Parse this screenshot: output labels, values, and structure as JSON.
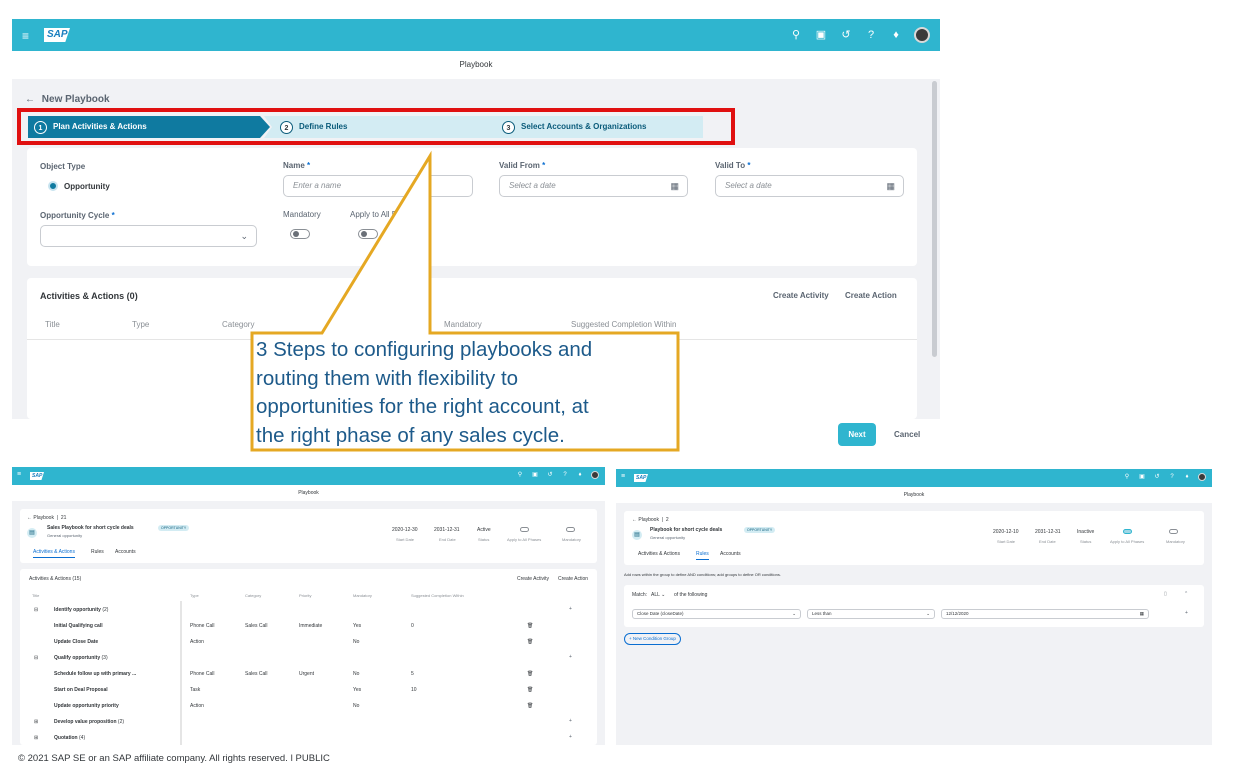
{
  "main": {
    "shell_menu_icon": "≡",
    "logo": "SAP",
    "page_title": "Playbook",
    "back_label": "New Playbook",
    "wizard": [
      {
        "num": "1",
        "label": "Plan Activities & Actions"
      },
      {
        "num": "2",
        "label": "Define Rules"
      },
      {
        "num": "3",
        "label": "Select Accounts & Organizations"
      }
    ],
    "form": {
      "object_type_label": "Object Type",
      "object_type_value": "Opportunity",
      "name_label": "Name",
      "name_placeholder": "Enter a name",
      "valid_from_label": "Valid From",
      "valid_from_placeholder": "Select a date",
      "valid_to_label": "Valid To",
      "valid_to_placeholder": "Select a date",
      "cycle_label": "Opportunity Cycle",
      "mandatory_label": "Mandatory",
      "apply_label": "Apply to All P",
      "required_mark": "*"
    },
    "activities": {
      "title": "Activities & Actions (0)",
      "create_activity": "Create Activity",
      "create_action": "Create Action",
      "columns": [
        "Title",
        "Type",
        "Category",
        "Mandatory",
        "Suggested Completion Within"
      ]
    },
    "next_label": "Next",
    "cancel_label": "Cancel"
  },
  "callout": {
    "lines": [
      "3 Steps to configuring playbooks and",
      "routing them with flexibility to",
      "opportunities for the right account, at",
      "the right phase of any sales cycle."
    ]
  },
  "mini1": {
    "logo": "SAP",
    "page_title": "Playbook",
    "breadcrumb": "Playbook",
    "breadcrumb_id": "21",
    "title": "Sales Playbook for short cycle deals",
    "badge": "OPPORTUNITY",
    "subtitle": "General opportunity",
    "stats": [
      {
        "value": "2020-12-30",
        "label": "Start Date"
      },
      {
        "value": "2031-12-31",
        "label": "End Date"
      },
      {
        "value": "Active",
        "label": "Status"
      },
      {
        "label": "Apply to All Phases"
      },
      {
        "label": "Mandatory"
      }
    ],
    "tabs": [
      "Activities & Actions",
      "Rules",
      "Accounts"
    ],
    "section_title": "Activities & Actions (15)",
    "create_activity": "Create Activity",
    "create_action": "Create Action",
    "columns": [
      "Title",
      "Type",
      "Category",
      "Priority",
      "Mandatory",
      "Suggested Completion Within"
    ],
    "rows": [
      {
        "kind": "group",
        "title": "Identify opportunity",
        "count": "(2)"
      },
      {
        "kind": "item",
        "title": "Initial Qualifying call",
        "type": "Phone Call",
        "category": "Sales Call",
        "priority": "Immediate",
        "mandatory": "Yes",
        "days": "0"
      },
      {
        "kind": "item",
        "title": "Update Close Date",
        "type": "Action",
        "category": "",
        "priority": "",
        "mandatory": "No",
        "days": ""
      },
      {
        "kind": "group",
        "title": "Qualify opportunity",
        "count": "(3)"
      },
      {
        "kind": "item",
        "title": "Schedule follow up with primary ...",
        "type": "Phone Call",
        "category": "Sales Call",
        "priority": "Urgent",
        "mandatory": "No",
        "days": "5"
      },
      {
        "kind": "item",
        "title": "Start on Deal Proposal",
        "type": "Task",
        "category": "",
        "priority": "",
        "mandatory": "Yes",
        "days": "10"
      },
      {
        "kind": "item",
        "title": "Update opportunity priority",
        "type": "Action",
        "category": "",
        "priority": "",
        "mandatory": "No",
        "days": ""
      },
      {
        "kind": "group",
        "title": "Develop value proposition",
        "count": "(2)"
      },
      {
        "kind": "group",
        "title": "Quotation",
        "count": "(4)"
      }
    ]
  },
  "mini2": {
    "logo": "SAP",
    "page_title": "Playbook",
    "breadcrumb": "Playbook",
    "breadcrumb_id": "2",
    "title": "Playbook for short cycle deals",
    "badge": "OPPORTUNITY",
    "subtitle": "General opportunity",
    "stats": [
      {
        "value": "2020-12-10",
        "label": "Start Date"
      },
      {
        "value": "2031-12-31",
        "label": "End Date"
      },
      {
        "value": "Inactive",
        "label": "Status"
      },
      {
        "label": "Apply to All Phases"
      },
      {
        "label": "Mandatory"
      }
    ],
    "tabs": [
      "Activities & Actions",
      "Rules",
      "Accounts"
    ],
    "hint": "Add rows within the group to define AND conditions; add groups to define OR conditions.",
    "match_label": "Match:",
    "match_value": "ALL",
    "match_suffix": "of the following",
    "condition_field": "Close Date (closeDate)",
    "condition_operator": "Less than",
    "condition_value": "12/12/2020",
    "new_group": "New Condition Group"
  },
  "footer": "© 2021 SAP SE or an SAP affiliate company. All rights reserved.  ǀ   PUBLIC"
}
